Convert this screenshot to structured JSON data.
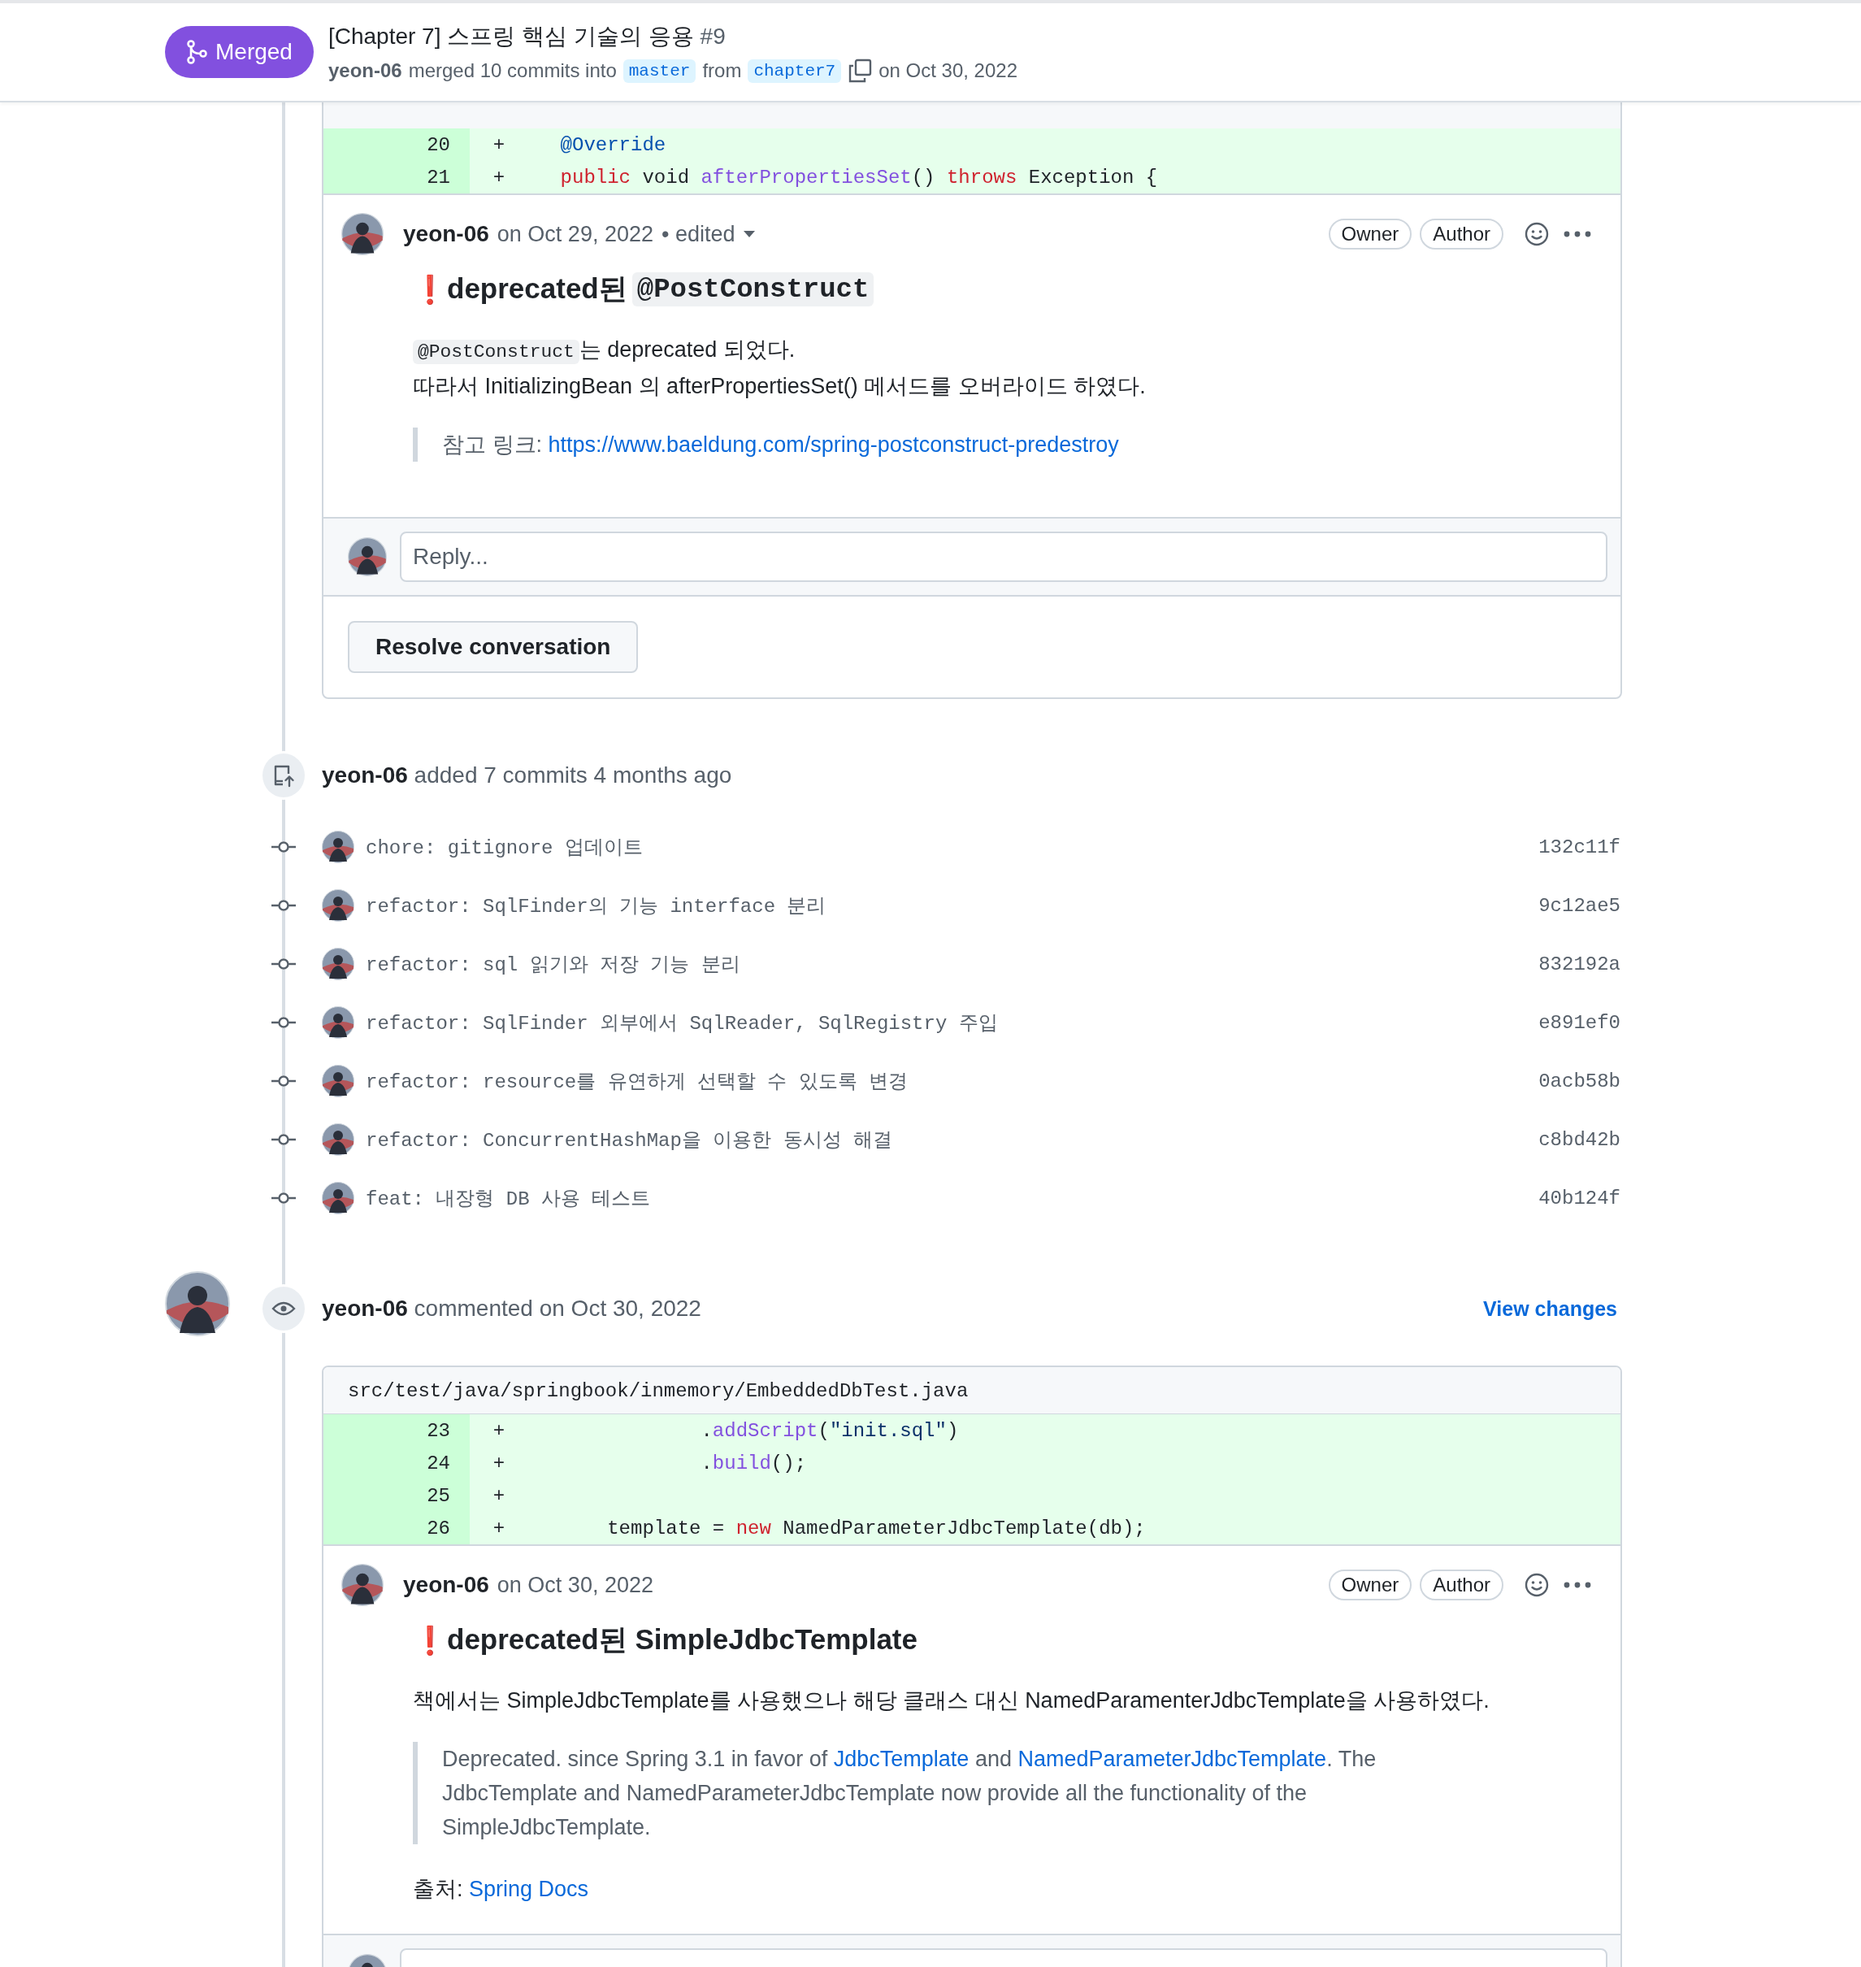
{
  "header": {
    "status": "Merged",
    "title": "[Chapter 7] 스프링 핵심 기술의 응용",
    "number": "#9",
    "author": "yeon-06",
    "merged_text": "merged 10 commits into",
    "base_branch": "master",
    "from_text": "from",
    "head_branch": "chapter7",
    "date": "on Oct 30, 2022"
  },
  "thread": {
    "diff_lines": [
      {
        "number": "20",
        "sign": "+",
        "tokens": [
          {
            "text": "    @Override",
            "kind": "annotation"
          }
        ]
      },
      {
        "number": "21",
        "sign": "+",
        "tokens": [
          {
            "text": "    public",
            "kind": "keyword"
          },
          {
            "text": " void ",
            "kind": "plain"
          },
          {
            "text": "afterPropertiesSet",
            "kind": "entity"
          },
          {
            "text": "() ",
            "kind": "plain"
          },
          {
            "text": "throws",
            "kind": "keyword"
          },
          {
            "text": " Exception {",
            "kind": "plain"
          }
        ]
      }
    ],
    "comment": {
      "author": "yeon-06",
      "date": "on Oct 29, 2022",
      "edited": "• edited",
      "badges": [
        "Owner",
        "Author"
      ],
      "heading": [
        {
          "text": "deprecated된 ",
          "kind": "text"
        },
        {
          "text": "@PostConstruct",
          "kind": "code"
        }
      ],
      "alert": "❗",
      "paragraphs": [
        [
          {
            "text": "@PostConstruct",
            "kind": "code"
          },
          {
            "text": "는 deprecated 되었다.",
            "kind": "text"
          }
        ],
        [
          {
            "text": "따라서 InitializingBean 의 afterPropertiesSet() 메서드를 오버라이드 하였다.",
            "kind": "text"
          }
        ]
      ],
      "quote": [
        {
          "text": "참고 링크: ",
          "kind": "text"
        },
        {
          "text": "https://www.baeldung.com/spring-postconstruct-predestroy",
          "kind": "link"
        }
      ]
    },
    "reply_placeholder": "Reply...",
    "resolve_button": "Resolve conversation"
  },
  "commit_event": {
    "author": "yeon-06",
    "text": "added 7 commits 4 months ago"
  },
  "commits": [
    {
      "message": "chore: gitignore 업데이트",
      "sha": "132c11f"
    },
    {
      "message": "refactor: SqlFinder의 기능 interface 분리",
      "sha": "9c12ae5"
    },
    {
      "message": "refactor: sql 읽기와 저장 기능 분리",
      "sha": "832192a"
    },
    {
      "message": "refactor: SqlFinder 외부에서 SqlReader, SqlRegistry 주입",
      "sha": "e891ef0"
    },
    {
      "message": "refactor: resource를 유연하게 선택할 수 있도록 변경",
      "sha": "0acb58b"
    },
    {
      "message": "refactor: ConcurrentHashMap을 이용한 동시성 해결",
      "sha": "c8bd42b"
    },
    {
      "message": "feat: 내장형 DB 사용 테스트",
      "sha": "40b124f"
    }
  ],
  "review": {
    "author": "yeon-06",
    "text": "commented on Oct 30, 2022",
    "view_changes": "View changes",
    "file_path": "src/test/java/springbook/inmemory/EmbeddedDbTest.java",
    "diff_lines": [
      {
        "number": "23",
        "sign": "+",
        "tokens": [
          {
            "text": "                .",
            "kind": "plain"
          },
          {
            "text": "addScript",
            "kind": "entity"
          },
          {
            "text": "(",
            "kind": "plain"
          },
          {
            "text": "\"init.sql\"",
            "kind": "string"
          },
          {
            "text": ")",
            "kind": "plain"
          }
        ]
      },
      {
        "number": "24",
        "sign": "+",
        "tokens": [
          {
            "text": "                .",
            "kind": "plain"
          },
          {
            "text": "build",
            "kind": "entity"
          },
          {
            "text": "();",
            "kind": "plain"
          }
        ]
      },
      {
        "number": "25",
        "sign": "+"
      },
      {
        "number": "26",
        "sign": "+",
        "tokens": [
          {
            "text": "        template = ",
            "kind": "plain"
          },
          {
            "text": "new",
            "kind": "keyword"
          },
          {
            "text": " NamedParameterJdbcTemplate(db);",
            "kind": "plain"
          }
        ]
      }
    ],
    "comment": {
      "author": "yeon-06",
      "date": "on Oct 30, 2022",
      "badges": [
        "Owner",
        "Author"
      ],
      "alert": "❗",
      "heading": [
        {
          "text": "deprecated된 SimpleJdbcTemplate",
          "kind": "text"
        }
      ],
      "paragraphs": [
        [
          {
            "text": "책에서는 SimpleJdbcTemplate를 사용했으나 해당 클래스 대신 NamedParamenterJdbcTemplate을 사용하였다.",
            "kind": "text"
          }
        ]
      ],
      "quote": [
        {
          "text": "Deprecated. since Spring 3.1 in favor of ",
          "kind": "text"
        },
        {
          "text": "JdbcTemplate",
          "kind": "link"
        },
        {
          "text": " and ",
          "kind": "text"
        },
        {
          "text": "NamedParameterJdbcTemplate",
          "kind": "link"
        },
        {
          "text": ". The JdbcTemplate and NamedParameterJdbcTemplate now provide all the functionality of the SimpleJdbcTemplate.",
          "kind": "text"
        }
      ],
      "source": [
        {
          "text": "출처: ",
          "kind": "text"
        },
        {
          "text": "Spring Docs",
          "kind": "link"
        }
      ]
    }
  }
}
